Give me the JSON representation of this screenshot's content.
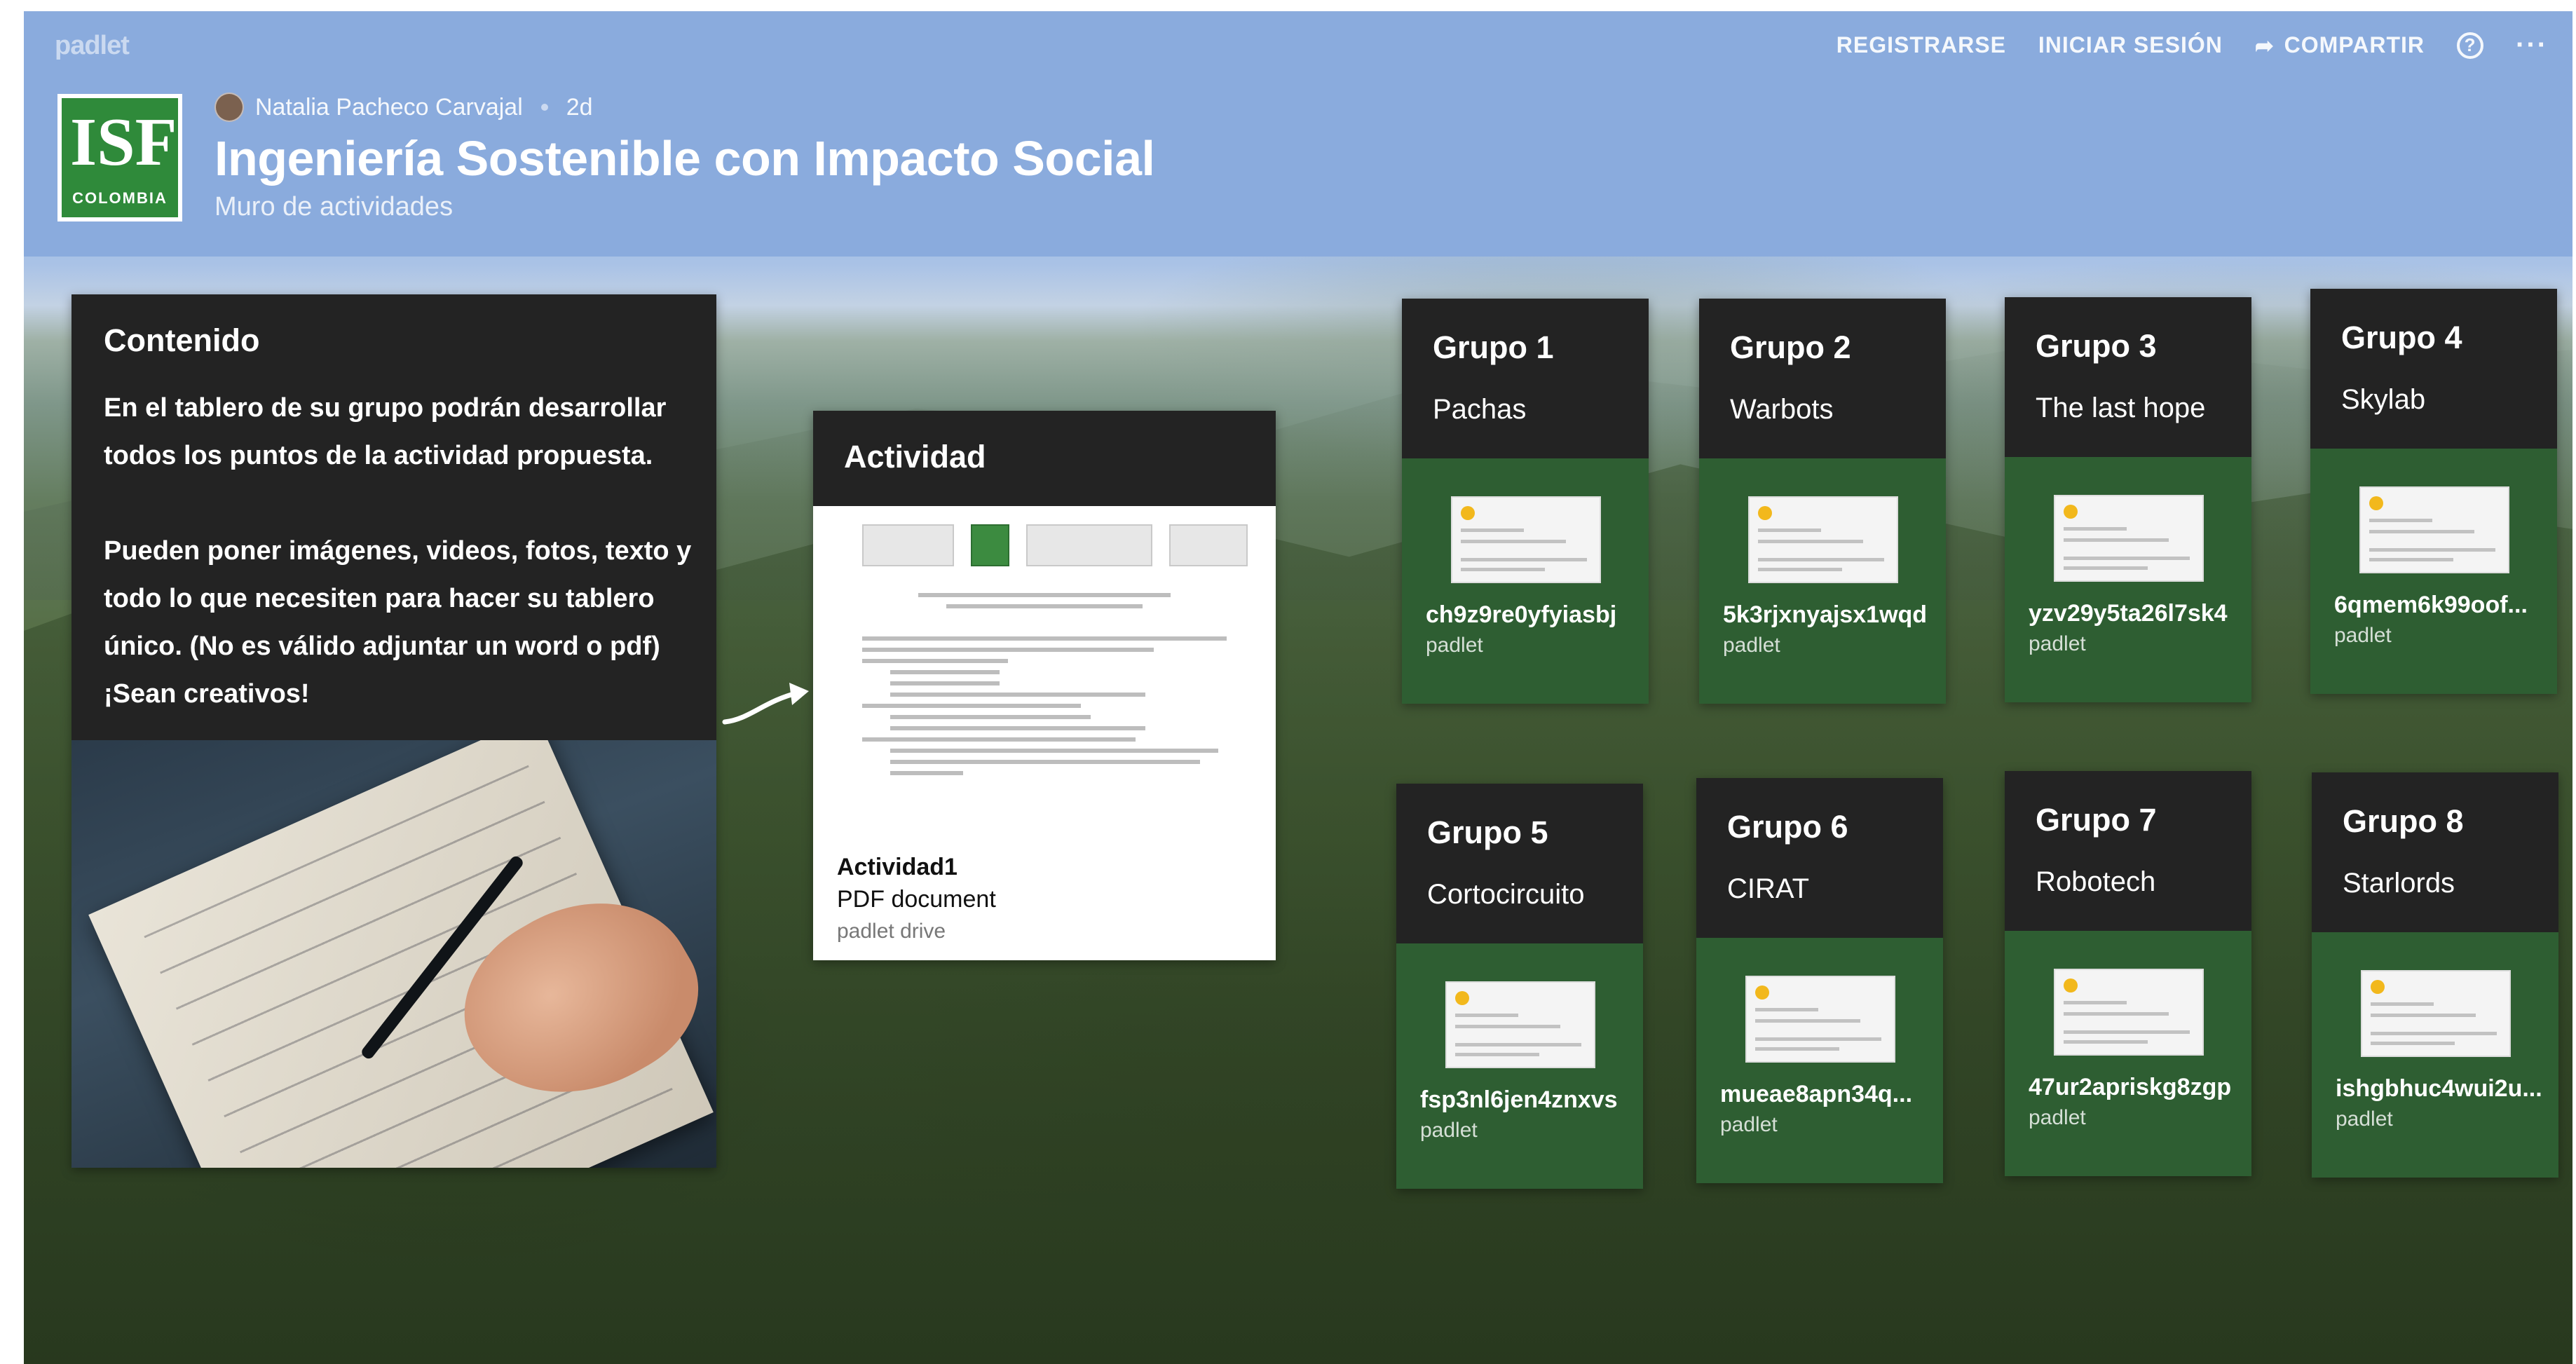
{
  "app": {
    "brand": "padlet"
  },
  "top_actions": {
    "register": "REGISTRARSE",
    "login": "INICIAR SESIÓN",
    "share": "COMPARTIR",
    "share_icon": "➦",
    "help_icon": "?",
    "more_icon": "···"
  },
  "header": {
    "logo_text": "COLOMBIA",
    "logo_glyph": "ISF",
    "author": "Natalia Pacheco Carvajal",
    "age": "2d",
    "title": "Ingeniería Sostenible con Impacto Social",
    "subtitle": "Muro de actividades"
  },
  "contenido": {
    "title": "Contenido",
    "p1": "En el tablero de su grupo podrán desarrollar todos los puntos de la actividad propuesta.",
    "p2": "Pueden poner imágenes, videos, fotos, texto y todo lo que necesiten para hacer su tablero único. (No es válido adjuntar un word o pdf) ¡Sean creativos!"
  },
  "actividad": {
    "title": "Actividad",
    "file_name": "Actividad1",
    "file_type": "PDF document",
    "file_source": "padlet drive"
  },
  "grupos": [
    {
      "title": "Grupo 1",
      "name": "Pachas",
      "slug": "ch9z9re0yfyiasbj",
      "source": "padlet"
    },
    {
      "title": "Grupo 2",
      "name": "Warbots",
      "slug": "5k3rjxnyajsx1wqd",
      "source": "padlet"
    },
    {
      "title": "Grupo 3",
      "name": "The last hope",
      "slug": "yzv29y5ta26l7sk4",
      "source": "padlet"
    },
    {
      "title": "Grupo 4",
      "name": "Skylab",
      "slug": "6qmem6k99oof...",
      "source": "padlet"
    },
    {
      "title": "Grupo 5",
      "name": "Cortocircuito",
      "slug": "fsp3nl6jen4znxvs",
      "source": "padlet"
    },
    {
      "title": "Grupo 6",
      "name": "CIRAT",
      "slug": "mueae8apn34q...",
      "source": "padlet"
    },
    {
      "title": "Grupo 7",
      "name": "Robotech",
      "slug": "47ur2apriskg8zgp",
      "source": "padlet"
    },
    {
      "title": "Grupo 8",
      "name": "Starlords",
      "slug": "ishgbhuc4wui2u...",
      "source": "padlet"
    }
  ],
  "colors": {
    "header_bg": "#8aabdd",
    "card_dark": "#232323",
    "group_green": "#2e5e32"
  }
}
